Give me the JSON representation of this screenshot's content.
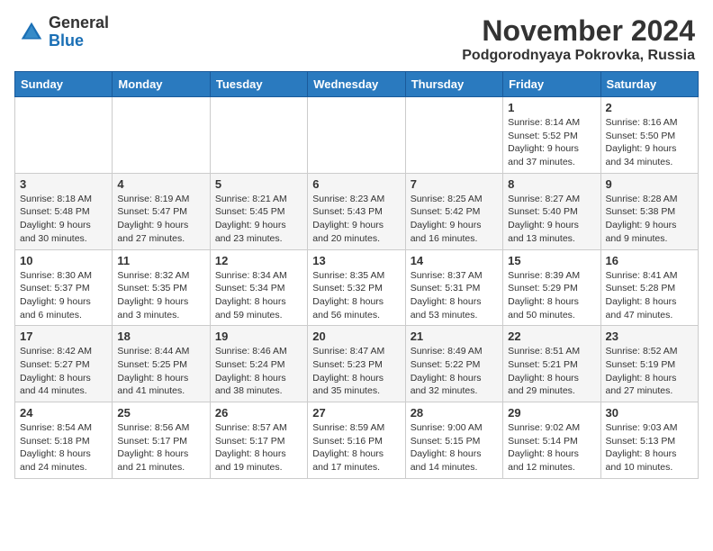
{
  "header": {
    "logo_general": "General",
    "logo_blue": "Blue",
    "title": "November 2024",
    "location": "Podgorodnyaya Pokrovka, Russia"
  },
  "calendar": {
    "days_of_week": [
      "Sunday",
      "Monday",
      "Tuesday",
      "Wednesday",
      "Thursday",
      "Friday",
      "Saturday"
    ],
    "weeks": [
      [
        {
          "day": "",
          "info": ""
        },
        {
          "day": "",
          "info": ""
        },
        {
          "day": "",
          "info": ""
        },
        {
          "day": "",
          "info": ""
        },
        {
          "day": "",
          "info": ""
        },
        {
          "day": "1",
          "info": "Sunrise: 8:14 AM\nSunset: 5:52 PM\nDaylight: 9 hours\nand 37 minutes."
        },
        {
          "day": "2",
          "info": "Sunrise: 8:16 AM\nSunset: 5:50 PM\nDaylight: 9 hours\nand 34 minutes."
        }
      ],
      [
        {
          "day": "3",
          "info": "Sunrise: 8:18 AM\nSunset: 5:48 PM\nDaylight: 9 hours\nand 30 minutes."
        },
        {
          "day": "4",
          "info": "Sunrise: 8:19 AM\nSunset: 5:47 PM\nDaylight: 9 hours\nand 27 minutes."
        },
        {
          "day": "5",
          "info": "Sunrise: 8:21 AM\nSunset: 5:45 PM\nDaylight: 9 hours\nand 23 minutes."
        },
        {
          "day": "6",
          "info": "Sunrise: 8:23 AM\nSunset: 5:43 PM\nDaylight: 9 hours\nand 20 minutes."
        },
        {
          "day": "7",
          "info": "Sunrise: 8:25 AM\nSunset: 5:42 PM\nDaylight: 9 hours\nand 16 minutes."
        },
        {
          "day": "8",
          "info": "Sunrise: 8:27 AM\nSunset: 5:40 PM\nDaylight: 9 hours\nand 13 minutes."
        },
        {
          "day": "9",
          "info": "Sunrise: 8:28 AM\nSunset: 5:38 PM\nDaylight: 9 hours\nand 9 minutes."
        }
      ],
      [
        {
          "day": "10",
          "info": "Sunrise: 8:30 AM\nSunset: 5:37 PM\nDaylight: 9 hours\nand 6 minutes."
        },
        {
          "day": "11",
          "info": "Sunrise: 8:32 AM\nSunset: 5:35 PM\nDaylight: 9 hours\nand 3 minutes."
        },
        {
          "day": "12",
          "info": "Sunrise: 8:34 AM\nSunset: 5:34 PM\nDaylight: 8 hours\nand 59 minutes."
        },
        {
          "day": "13",
          "info": "Sunrise: 8:35 AM\nSunset: 5:32 PM\nDaylight: 8 hours\nand 56 minutes."
        },
        {
          "day": "14",
          "info": "Sunrise: 8:37 AM\nSunset: 5:31 PM\nDaylight: 8 hours\nand 53 minutes."
        },
        {
          "day": "15",
          "info": "Sunrise: 8:39 AM\nSunset: 5:29 PM\nDaylight: 8 hours\nand 50 minutes."
        },
        {
          "day": "16",
          "info": "Sunrise: 8:41 AM\nSunset: 5:28 PM\nDaylight: 8 hours\nand 47 minutes."
        }
      ],
      [
        {
          "day": "17",
          "info": "Sunrise: 8:42 AM\nSunset: 5:27 PM\nDaylight: 8 hours\nand 44 minutes."
        },
        {
          "day": "18",
          "info": "Sunrise: 8:44 AM\nSunset: 5:25 PM\nDaylight: 8 hours\nand 41 minutes."
        },
        {
          "day": "19",
          "info": "Sunrise: 8:46 AM\nSunset: 5:24 PM\nDaylight: 8 hours\nand 38 minutes."
        },
        {
          "day": "20",
          "info": "Sunrise: 8:47 AM\nSunset: 5:23 PM\nDaylight: 8 hours\nand 35 minutes."
        },
        {
          "day": "21",
          "info": "Sunrise: 8:49 AM\nSunset: 5:22 PM\nDaylight: 8 hours\nand 32 minutes."
        },
        {
          "day": "22",
          "info": "Sunrise: 8:51 AM\nSunset: 5:21 PM\nDaylight: 8 hours\nand 29 minutes."
        },
        {
          "day": "23",
          "info": "Sunrise: 8:52 AM\nSunset: 5:19 PM\nDaylight: 8 hours\nand 27 minutes."
        }
      ],
      [
        {
          "day": "24",
          "info": "Sunrise: 8:54 AM\nSunset: 5:18 PM\nDaylight: 8 hours\nand 24 minutes."
        },
        {
          "day": "25",
          "info": "Sunrise: 8:56 AM\nSunset: 5:17 PM\nDaylight: 8 hours\nand 21 minutes."
        },
        {
          "day": "26",
          "info": "Sunrise: 8:57 AM\nSunset: 5:17 PM\nDaylight: 8 hours\nand 19 minutes."
        },
        {
          "day": "27",
          "info": "Sunrise: 8:59 AM\nSunset: 5:16 PM\nDaylight: 8 hours\nand 17 minutes."
        },
        {
          "day": "28",
          "info": "Sunrise: 9:00 AM\nSunset: 5:15 PM\nDaylight: 8 hours\nand 14 minutes."
        },
        {
          "day": "29",
          "info": "Sunrise: 9:02 AM\nSunset: 5:14 PM\nDaylight: 8 hours\nand 12 minutes."
        },
        {
          "day": "30",
          "info": "Sunrise: 9:03 AM\nSunset: 5:13 PM\nDaylight: 8 hours\nand 10 minutes."
        }
      ]
    ]
  }
}
